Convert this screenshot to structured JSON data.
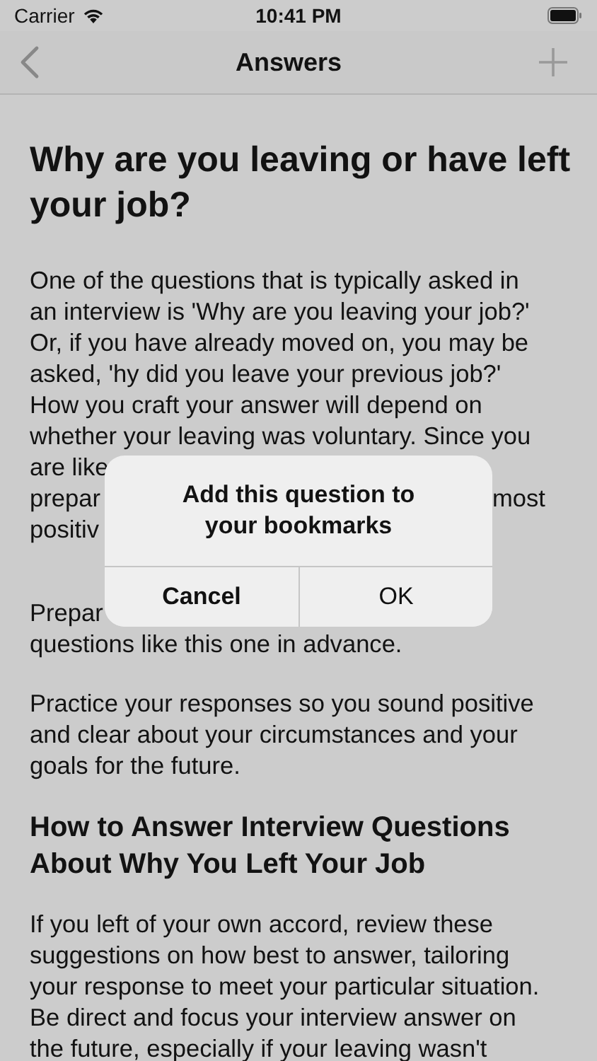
{
  "status_bar": {
    "carrier": "Carrier",
    "time": "10:41 PM"
  },
  "nav": {
    "title": "Answers"
  },
  "content": [
    {
      "kind": "title",
      "lines": [
        {
          "text": "Why are you leaving or have left"
        },
        {
          "text": "your job?"
        }
      ]
    },
    {
      "kind": "paragraph",
      "lines": [
        {
          "text": "One of the questions that is typically asked in"
        },
        {
          "text": "an interview is 'Why are you leaving your job?'"
        },
        {
          "text": "Or, if you have already moved on, you may be"
        },
        {
          "text": "asked, 'hy did you leave your previous job?'"
        },
        {
          "text": "How you craft your answer will depend on"
        },
        {
          "text": "whether your leaving was voluntary. Since you"
        },
        {
          "text": "are like"
        },
        {
          "text": "prepar",
          "after_alert": "most"
        },
        {
          "text": "positiv"
        }
      ]
    },
    {
      "kind": "paragraph",
      "lines": [
        {
          "text": "Prepar"
        },
        {
          "text": "questions like this one in advance."
        }
      ]
    },
    {
      "kind": "paragraph",
      "lines": [
        {
          "text": "Practice your responses so you sound positive"
        },
        {
          "text": "and clear about your circumstances and your"
        },
        {
          "text": "goals for the future."
        }
      ]
    },
    {
      "kind": "heading",
      "lines": [
        {
          "text": "How to Answer Interview Questions"
        },
        {
          "text": "About Why You Left Your Job"
        }
      ]
    },
    {
      "kind": "paragraph",
      "lines": [
        {
          "text": "If you left of your own accord, review these"
        },
        {
          "text": "suggestions on how best to answer, tailoring"
        },
        {
          "text": "your response to meet your particular situation."
        },
        {
          "text": "Be direct and focus your interview answer on"
        },
        {
          "text": "the future, especially if your leaving wasn't"
        }
      ]
    }
  ],
  "alert": {
    "message": "Add this question to your bookmarks",
    "buttons": [
      {
        "label": "Cancel",
        "kind": "cancel"
      },
      {
        "label": "OK",
        "kind": "default"
      }
    ]
  }
}
